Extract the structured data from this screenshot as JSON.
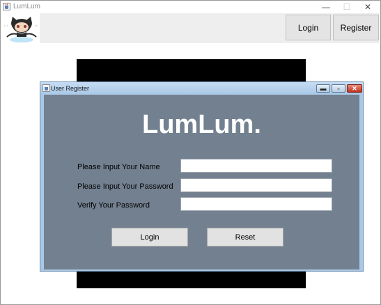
{
  "window": {
    "title": "LumLum",
    "icon": "java-cup-icon",
    "controls": {
      "minimize": "—",
      "maximize": "☐",
      "close": "✕"
    }
  },
  "header": {
    "avatar": "octocat-icon",
    "login_label": "Login",
    "register_label": "Register"
  },
  "dialog": {
    "title": "User Register",
    "icon": "java-cup-icon",
    "controls": {
      "minimize": "▬",
      "maximize": "▫",
      "close": "✕"
    },
    "brand": "LumLum.",
    "fields": [
      {
        "label": "Please Input Your Name",
        "value": "",
        "type": "text"
      },
      {
        "label": "Please Input Your Password",
        "value": "",
        "type": "password"
      },
      {
        "label": "Verify Your Password",
        "value": "",
        "type": "password"
      }
    ],
    "login_label": "Login",
    "reset_label": "Reset",
    "colors": {
      "body": "#738090",
      "frame": "#a9c8e6"
    }
  }
}
